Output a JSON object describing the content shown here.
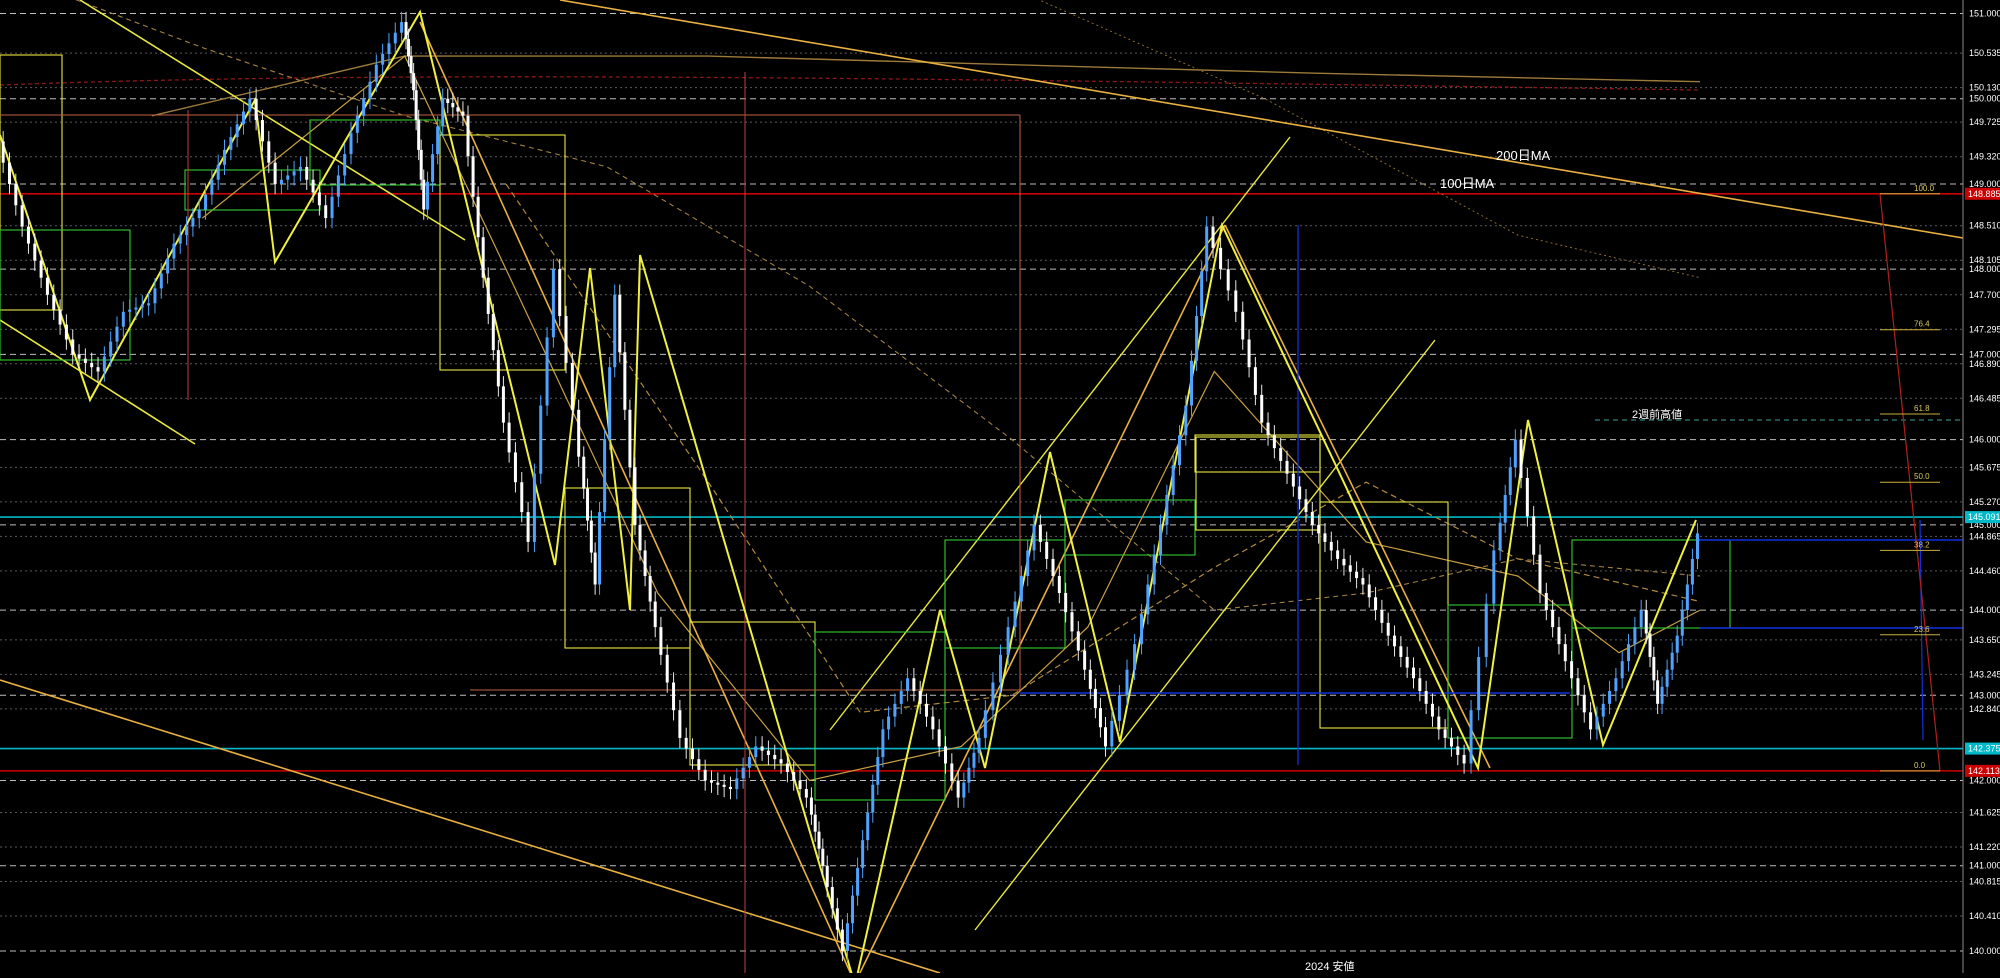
{
  "chart_data": {
    "type": "line",
    "title": "",
    "xlabel": "",
    "ylabel": "",
    "ylim": [
      139.8,
      151.1
    ],
    "grid": true,
    "price_axis": {
      "ticks": [
        "151.000",
        "150.535",
        "150.130",
        "150.000",
        "149.725",
        "149.320",
        "149.000",
        "148.510",
        "148.105",
        "148.000",
        "147.700",
        "147.295",
        "147.000",
        "146.890",
        "146.485",
        "146.000",
        "145.675",
        "145.270",
        "145.000",
        "144.865",
        "144.460",
        "144.000",
        "143.650",
        "143.245",
        "143.000",
        "142.840",
        "142.000",
        "141.625",
        "141.220",
        "141.000",
        "140.815",
        "140.410",
        "140.000"
      ],
      "highlighted": [
        {
          "label": "148.885",
          "color": "#cc0000"
        },
        {
          "label": "145.091",
          "color": "#00b8c8"
        },
        {
          "label": "142.375",
          "color": "#00b8c8"
        },
        {
          "label": "142.113",
          "color": "#cc0000"
        }
      ]
    },
    "annotations": {
      "ma200": "200日MA",
      "ma100": "100日MA",
      "high_2w": "2週前高値",
      "low_2024": "2024 安値"
    },
    "fib_levels": [
      {
        "label": "100.0",
        "price": 148.885
      },
      {
        "label": "76.4",
        "price": 147.29
      },
      {
        "label": "61.8",
        "price": 146.3
      },
      {
        "label": "50.0",
        "price": 145.5
      },
      {
        "label": "38.2",
        "price": 144.7
      },
      {
        "label": "23.6",
        "price": 143.71
      },
      {
        "label": "0.0",
        "price": 142.113
      }
    ],
    "series": [
      {
        "price_path": [
          [
            0,
            149.5
          ],
          [
            5,
            148.5
          ],
          [
            10,
            147.7
          ],
          [
            15,
            147.0
          ],
          [
            20,
            146.8
          ],
          [
            25,
            147.5
          ],
          [
            30,
            147.6
          ],
          [
            35,
            148.3
          ],
          [
            40,
            148.7
          ],
          [
            45,
            149.4
          ],
          [
            50,
            150.0
          ],
          [
            55,
            149.0
          ],
          [
            60,
            149.2
          ],
          [
            65,
            148.6
          ],
          [
            70,
            149.6
          ],
          [
            75,
            150.4
          ],
          [
            80,
            150.9
          ],
          [
            82,
            150.1
          ],
          [
            84,
            148.7
          ],
          [
            88,
            150.0
          ],
          [
            92,
            149.8
          ],
          [
            96,
            147.9
          ],
          [
            100,
            146.2
          ],
          [
            105,
            144.8
          ],
          [
            110,
            148.0
          ],
          [
            115,
            145.8
          ],
          [
            118,
            144.3
          ],
          [
            122,
            147.7
          ],
          [
            126,
            145.0
          ],
          [
            130,
            143.8
          ],
          [
            135,
            142.5
          ],
          [
            140,
            142.0
          ],
          [
            145,
            141.9
          ],
          [
            150,
            142.4
          ],
          [
            155,
            142.2
          ],
          [
            160,
            141.8
          ],
          [
            163,
            141.0
          ],
          [
            167,
            140.0
          ],
          [
            171,
            141.3
          ],
          [
            175,
            142.6
          ],
          [
            180,
            143.2
          ],
          [
            185,
            142.6
          ],
          [
            190,
            141.8
          ],
          [
            194,
            142.5
          ],
          [
            200,
            143.8
          ],
          [
            205,
            145.0
          ],
          [
            210,
            144.2
          ],
          [
            215,
            143.3
          ],
          [
            219,
            142.4
          ],
          [
            225,
            143.6
          ],
          [
            230,
            145.0
          ],
          [
            235,
            146.4
          ],
          [
            239,
            148.5
          ],
          [
            245,
            147.5
          ],
          [
            250,
            146.2
          ],
          [
            255,
            145.6
          ],
          [
            260,
            145.0
          ],
          [
            265,
            144.6
          ],
          [
            270,
            144.3
          ],
          [
            275,
            143.7
          ],
          [
            280,
            143.2
          ],
          [
            285,
            142.6
          ],
          [
            290,
            142.2
          ],
          [
            296,
            144.7
          ],
          [
            300,
            146.0
          ],
          [
            305,
            144.2
          ],
          [
            310,
            143.4
          ],
          [
            315,
            142.6
          ],
          [
            320,
            143.2
          ],
          [
            325,
            144.0
          ],
          [
            328,
            142.9
          ],
          [
            332,
            143.7
          ],
          [
            336,
            144.9
          ]
        ],
        "ma_fast": [
          [
            40,
            148.6
          ],
          [
            80,
            150.5
          ],
          [
            100,
            148.0
          ],
          [
            130,
            144.2
          ],
          [
            160,
            142.0
          ],
          [
            190,
            142.4
          ],
          [
            215,
            143.8
          ],
          [
            240,
            146.8
          ],
          [
            270,
            144.8
          ],
          [
            300,
            144.4
          ],
          [
            320,
            143.5
          ],
          [
            336,
            144.0
          ]
        ],
        "ma_mid": [
          [
            100,
            149.0
          ],
          [
            140,
            145.5
          ],
          [
            170,
            142.8
          ],
          [
            200,
            143.0
          ],
          [
            240,
            144.5
          ],
          [
            270,
            145.5
          ],
          [
            300,
            144.6
          ],
          [
            336,
            144.1
          ]
        ],
        "ma100": [
          [
            0,
            151.5
          ],
          [
            40,
            150.6
          ],
          [
            80,
            149.8
          ],
          [
            120,
            149.2
          ],
          [
            160,
            147.8
          ],
          [
            200,
            146.0
          ],
          [
            240,
            144.0
          ],
          [
            270,
            144.2
          ],
          [
            300,
            144.6
          ],
          [
            336,
            144.4
          ]
        ],
        "ma200": [
          [
            30,
            149.8
          ],
          [
            80,
            150.5
          ],
          [
            140,
            150.5
          ],
          [
            200,
            150.4
          ],
          [
            260,
            150.3
          ],
          [
            336,
            150.2
          ]
        ],
        "ma_slow_down": [
          [
            150,
            152.5
          ],
          [
            200,
            151.3
          ],
          [
            250,
            150.0
          ],
          [
            300,
            148.4
          ],
          [
            336,
            147.9
          ]
        ]
      }
    ]
  }
}
